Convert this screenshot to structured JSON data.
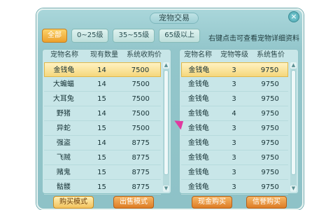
{
  "window": {
    "title": "宠物交易",
    "close_label": "×"
  },
  "filters": [
    {
      "label": "全部",
      "active": true
    },
    {
      "label": "0~25级",
      "active": false
    },
    {
      "label": "35~55级",
      "active": false
    },
    {
      "label": "65级以上",
      "active": false
    }
  ],
  "hint": "右键点击可查看宠物详细资料",
  "left_table": {
    "headers": [
      "宠物名称",
      "现有数量",
      "系统收购价"
    ],
    "rows": [
      [
        "金钱龟",
        "14",
        "7500"
      ],
      [
        "大蝙蝠",
        "14",
        "7500"
      ],
      [
        "大耳兔",
        "15",
        "7500"
      ],
      [
        "野猪",
        "14",
        "7500"
      ],
      [
        "异蛇",
        "15",
        "7500"
      ],
      [
        "强盗",
        "14",
        "8775"
      ],
      [
        "飞贼",
        "15",
        "8775"
      ],
      [
        "赌鬼",
        "15",
        "8775"
      ],
      [
        "骷髅",
        "15",
        "8775"
      ]
    ],
    "selected_index": 0
  },
  "right_table": {
    "headers": [
      "宠物名称",
      "宠物等级",
      "系统售价"
    ],
    "rows": [
      [
        "金钱龟",
        "3",
        "9750"
      ],
      [
        "金钱龟",
        "3",
        "9750"
      ],
      [
        "金钱龟",
        "3",
        "9750"
      ],
      [
        "金钱龟",
        "4",
        "9750"
      ],
      [
        "金钱龟",
        "3",
        "9750"
      ],
      [
        "金钱龟",
        "3",
        "9750"
      ],
      [
        "金钱龟",
        "3",
        "9750"
      ],
      [
        "金钱龟",
        "3",
        "9750"
      ],
      [
        "金钱龟",
        "3",
        "9750"
      ]
    ],
    "selected_index": 0
  },
  "bottom_buttons": [
    {
      "label": "购买模式",
      "active": true
    },
    {
      "label": "出售模式",
      "active": false
    },
    {
      "label": "现金购买",
      "active": false
    },
    {
      "label": "信誉购买",
      "active": false
    }
  ],
  "scroll": {
    "up": "▲",
    "down": "▼"
  }
}
